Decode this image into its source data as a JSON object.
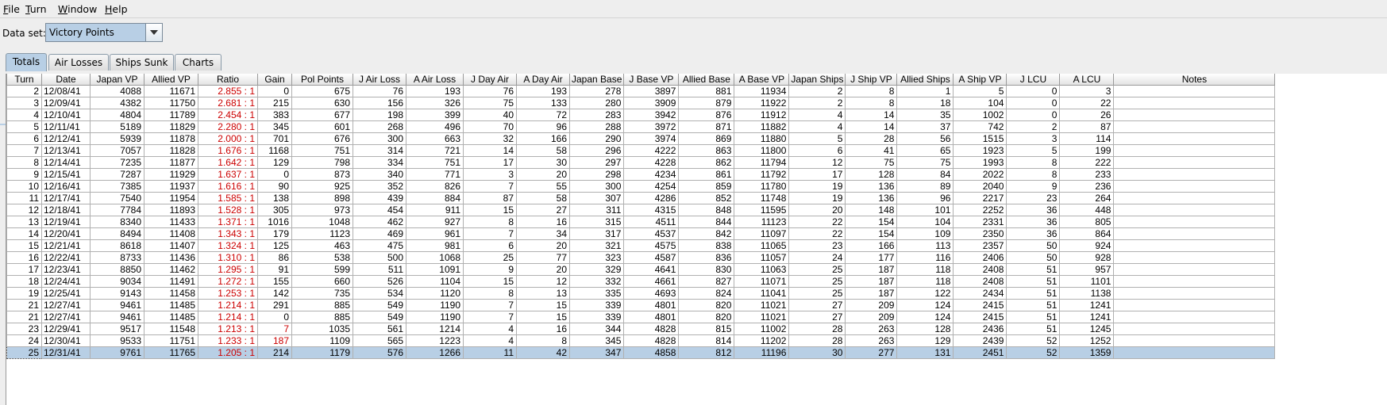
{
  "menu": [
    "File",
    "Turn",
    "Window",
    "Help"
  ],
  "menu_mnemonics": [
    "F",
    "T",
    "W",
    "H"
  ],
  "dataset": {
    "label": "Data set:",
    "value": "Victory Points"
  },
  "tabs": [
    "Totals",
    "Air Losses",
    "Ships Sunk",
    "Charts"
  ],
  "active_tab": "Totals",
  "table": {
    "columns": [
      "Turn",
      "Date",
      "Japan VP",
      "Allied VP",
      "Ratio",
      "Gain",
      "Pol Points",
      "J Air Loss",
      "A Air Loss",
      "J Day Air",
      "A Day Air",
      "Japan Base",
      "J Base VP",
      "Allied Base",
      "A Base VP",
      "Japan Ships",
      "J Ship VP",
      "Allied Ships",
      "A Ship VP",
      "J LCU",
      "A LCU",
      "Notes"
    ],
    "rows": [
      [
        "2",
        "12/08/41",
        "4088",
        "11671",
        "2.855 : 1",
        "0",
        "675",
        "76",
        "193",
        "76",
        "193",
        "278",
        "3897",
        "881",
        "11934",
        "2",
        "8",
        "1",
        "5",
        "0",
        "3",
        ""
      ],
      [
        "3",
        "12/09/41",
        "4382",
        "11750",
        "2.681 : 1",
        "215",
        "630",
        "156",
        "326",
        "75",
        "133",
        "280",
        "3909",
        "879",
        "11922",
        "2",
        "8",
        "18",
        "104",
        "0",
        "22",
        ""
      ],
      [
        "4",
        "12/10/41",
        "4804",
        "11789",
        "2.454 : 1",
        "383",
        "677",
        "198",
        "399",
        "40",
        "72",
        "283",
        "3942",
        "876",
        "11912",
        "4",
        "14",
        "35",
        "1002",
        "0",
        "26",
        ""
      ],
      [
        "5",
        "12/11/41",
        "5189",
        "11829",
        "2.280 : 1",
        "345",
        "601",
        "268",
        "496",
        "70",
        "96",
        "288",
        "3972",
        "871",
        "11882",
        "4",
        "14",
        "37",
        "742",
        "2",
        "87",
        ""
      ],
      [
        "6",
        "12/12/41",
        "5939",
        "11878",
        "2.000 : 1",
        "701",
        "676",
        "300",
        "663",
        "32",
        "166",
        "290",
        "3974",
        "869",
        "11880",
        "5",
        "28",
        "56",
        "1515",
        "3",
        "114",
        ""
      ],
      [
        "7",
        "12/13/41",
        "7057",
        "11828",
        "1.676 : 1",
        "1168",
        "751",
        "314",
        "721",
        "14",
        "58",
        "296",
        "4222",
        "863",
        "11800",
        "6",
        "41",
        "65",
        "1923",
        "5",
        "199",
        ""
      ],
      [
        "8",
        "12/14/41",
        "7235",
        "11877",
        "1.642 : 1",
        "129",
        "798",
        "334",
        "751",
        "17",
        "30",
        "297",
        "4228",
        "862",
        "11794",
        "12",
        "75",
        "75",
        "1993",
        "8",
        "222",
        ""
      ],
      [
        "9",
        "12/15/41",
        "7287",
        "11929",
        "1.637 : 1",
        "0",
        "873",
        "340",
        "771",
        "3",
        "20",
        "298",
        "4234",
        "861",
        "11792",
        "17",
        "128",
        "84",
        "2022",
        "8",
        "233",
        ""
      ],
      [
        "10",
        "12/16/41",
        "7385",
        "11937",
        "1.616 : 1",
        "90",
        "925",
        "352",
        "826",
        "7",
        "55",
        "300",
        "4254",
        "859",
        "11780",
        "19",
        "136",
        "89",
        "2040",
        "9",
        "236",
        ""
      ],
      [
        "11",
        "12/17/41",
        "7540",
        "11954",
        "1.585 : 1",
        "138",
        "898",
        "439",
        "884",
        "87",
        "58",
        "307",
        "4286",
        "852",
        "11748",
        "19",
        "136",
        "96",
        "2217",
        "23",
        "264",
        ""
      ],
      [
        "12",
        "12/18/41",
        "7784",
        "11893",
        "1.528 : 1",
        "305",
        "973",
        "454",
        "911",
        "15",
        "27",
        "311",
        "4315",
        "848",
        "11595",
        "20",
        "148",
        "101",
        "2252",
        "36",
        "448",
        ""
      ],
      [
        "13",
        "12/19/41",
        "8340",
        "11433",
        "1.371 : 1",
        "1016",
        "1048",
        "462",
        "927",
        "8",
        "16",
        "315",
        "4511",
        "844",
        "11123",
        "22",
        "154",
        "104",
        "2331",
        "36",
        "805",
        ""
      ],
      [
        "14",
        "12/20/41",
        "8494",
        "11408",
        "1.343 : 1",
        "179",
        "1123",
        "469",
        "961",
        "7",
        "34",
        "317",
        "4537",
        "842",
        "11097",
        "22",
        "154",
        "109",
        "2350",
        "36",
        "864",
        ""
      ],
      [
        "15",
        "12/21/41",
        "8618",
        "11407",
        "1.324 : 1",
        "125",
        "463",
        "475",
        "981",
        "6",
        "20",
        "321",
        "4575",
        "838",
        "11065",
        "23",
        "166",
        "113",
        "2357",
        "50",
        "924",
        ""
      ],
      [
        "16",
        "12/22/41",
        "8733",
        "11436",
        "1.310 : 1",
        "86",
        "538",
        "500",
        "1068",
        "25",
        "77",
        "323",
        "4587",
        "836",
        "11057",
        "24",
        "177",
        "116",
        "2406",
        "50",
        "928",
        ""
      ],
      [
        "17",
        "12/23/41",
        "8850",
        "11462",
        "1.295 : 1",
        "91",
        "599",
        "511",
        "1091",
        "9",
        "20",
        "329",
        "4641",
        "830",
        "11063",
        "25",
        "187",
        "118",
        "2408",
        "51",
        "957",
        ""
      ],
      [
        "18",
        "12/24/41",
        "9034",
        "11491",
        "1.272 : 1",
        "155",
        "660",
        "526",
        "1104",
        "15",
        "12",
        "332",
        "4661",
        "827",
        "11071",
        "25",
        "187",
        "118",
        "2408",
        "51",
        "1101",
        ""
      ],
      [
        "19",
        "12/25/41",
        "9143",
        "11458",
        "1.253 : 1",
        "142",
        "735",
        "534",
        "1120",
        "8",
        "13",
        "335",
        "4693",
        "824",
        "11041",
        "25",
        "187",
        "122",
        "2434",
        "51",
        "1138",
        ""
      ],
      [
        "21",
        "12/27/41",
        "9461",
        "11485",
        "1.214 : 1",
        "291",
        "885",
        "549",
        "1190",
        "7",
        "15",
        "339",
        "4801",
        "820",
        "11021",
        "27",
        "209",
        "124",
        "2415",
        "51",
        "1241",
        ""
      ],
      [
        "21",
        "12/27/41",
        "9461",
        "11485",
        "1.214 : 1",
        "0",
        "885",
        "549",
        "1190",
        "7",
        "15",
        "339",
        "4801",
        "820",
        "11021",
        "27",
        "209",
        "124",
        "2415",
        "51",
        "1241",
        ""
      ],
      [
        "23",
        "12/29/41",
        "9517",
        "11548",
        "1.213 : 1",
        "7",
        "1035",
        "561",
        "1214",
        "4",
        "16",
        "344",
        "4828",
        "815",
        "11002",
        "28",
        "263",
        "128",
        "2436",
        "51",
        "1245",
        ""
      ],
      [
        "24",
        "12/30/41",
        "9533",
        "11751",
        "1.233 : 1",
        "187",
        "1109",
        "565",
        "1223",
        "4",
        "8",
        "345",
        "4828",
        "814",
        "11202",
        "28",
        "263",
        "129",
        "2439",
        "52",
        "1252",
        ""
      ],
      [
        "25",
        "12/31/41",
        "9761",
        "11765",
        "1.205 : 1",
        "214",
        "1179",
        "576",
        "1266",
        "11",
        "42",
        "347",
        "4858",
        "812",
        "11196",
        "30",
        "277",
        "131",
        "2451",
        "52",
        "1359",
        ""
      ]
    ],
    "selected_row_index": 22,
    "red_gain_row_indices": [
      20,
      21
    ],
    "colors": {
      "ratio_text": "#cc0000",
      "selection": "#b8cfe5",
      "tab_active": "#b8cfe5"
    }
  }
}
